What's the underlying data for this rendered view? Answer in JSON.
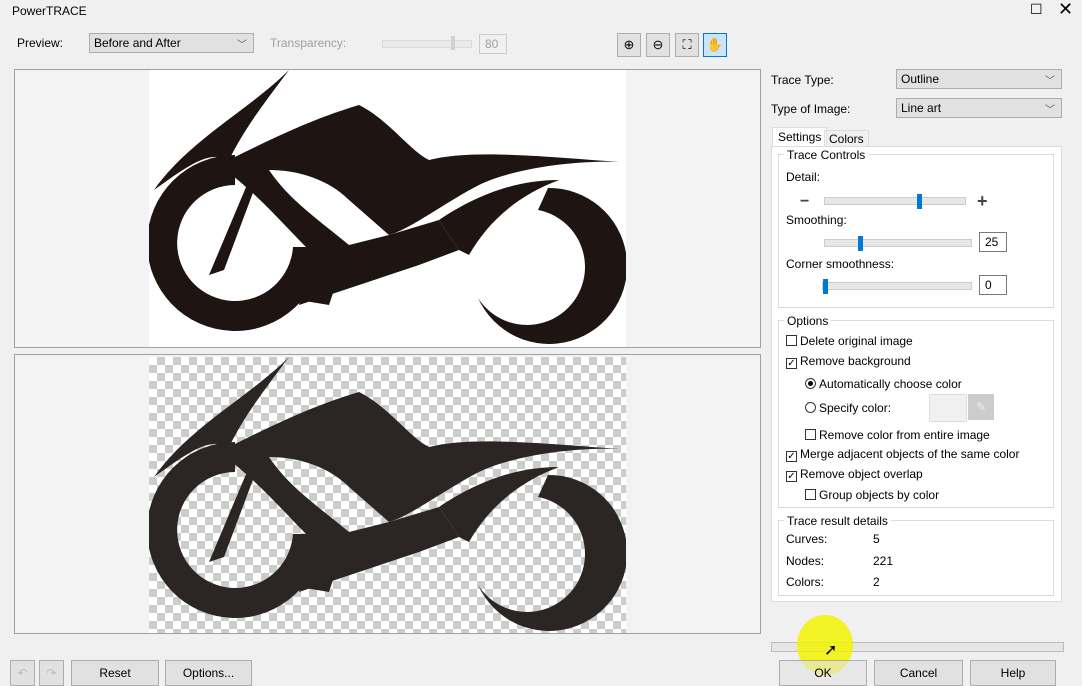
{
  "window": {
    "title": "PowerTRACE",
    "maximize_icon": "maximize-icon",
    "close_icon": "close-icon"
  },
  "toolbar": {
    "preview_label": "Preview:",
    "preview_value": "Before and After",
    "transparency_label": "Transparency:",
    "transparency_value": "80",
    "tools": [
      "zoom-in-icon",
      "zoom-out-icon",
      "fit-icon",
      "pan-hand-icon"
    ]
  },
  "right": {
    "trace_type_label": "Trace Type:",
    "trace_type_value": "Outline",
    "image_type_label": "Type of Image:",
    "image_type_value": "Line art",
    "tabs": [
      "Settings",
      "Colors"
    ],
    "trace_controls": {
      "title": "Trace Controls",
      "detail_label": "Detail:",
      "detail_level": 0.67,
      "smoothing_label": "Smoothing:",
      "smoothing_value": "25",
      "corner_label": "Corner smoothness:",
      "corner_value": "0"
    },
    "options": {
      "title": "Options",
      "delete_original": "Delete original image",
      "remove_background": "Remove background",
      "auto_color": "Automatically choose color",
      "specify_color": "Specify color:",
      "remove_color_entire": "Remove color from entire image",
      "merge_adjacent": "Merge adjacent objects of the same color",
      "remove_overlap": "Remove object overlap",
      "group_by_color": "Group objects by color"
    },
    "details": {
      "title": "Trace result details",
      "curves_label": "Curves:",
      "curves": "5",
      "nodes_label": "Nodes:",
      "nodes": "221",
      "colors_label": "Colors:",
      "colors": "2"
    }
  },
  "bottom": {
    "reset": "Reset",
    "options": "Options...",
    "ok": "OK",
    "cancel": "Cancel",
    "help": "Help"
  },
  "colors": {
    "accent": "#0078d7",
    "shape_before": "#1e1512",
    "shape_after": "#2b2624",
    "highlight": "#f2f200"
  }
}
